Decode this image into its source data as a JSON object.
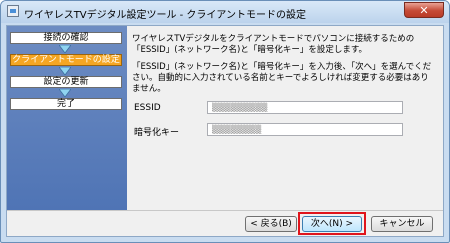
{
  "window": {
    "title": "ワイヤレスTVデジタル設定ツール - クライアントモードの設定",
    "close_label": "✕"
  },
  "steps": [
    {
      "label": "接続の確認",
      "active": false
    },
    {
      "label": "クライアントモードの設定",
      "active": true
    },
    {
      "label": "設定の更新",
      "active": false
    },
    {
      "label": "完了",
      "active": false
    }
  ],
  "content": {
    "intro": "ワイヤレスTVデジタルをクライアントモードでパソコンに接続するための「ESSID」(ネットワーク名)と「暗号化キー」を設定します。",
    "instructions": "「ESSID」(ネットワーク名)と「暗号化キー」を入力後、「次へ」を選んでください。自動的に入力されている名前とキーでよろしければ変更する必要はありません。"
  },
  "form": {
    "essid_label": "ESSID",
    "essid_value": "▒▒▒▒▒▒▒▒▒",
    "key_label": "暗号化キー",
    "key_value": "▒▒▒▒▒▒▒▒"
  },
  "buttons": {
    "back": "< 戻る(B)",
    "next": "次へ(N) >",
    "cancel": "キャンセル"
  },
  "colors": {
    "accent_active_step": "#f5a623",
    "highlight_frame": "#e0141b",
    "step_panel": "#5a7fbf"
  }
}
